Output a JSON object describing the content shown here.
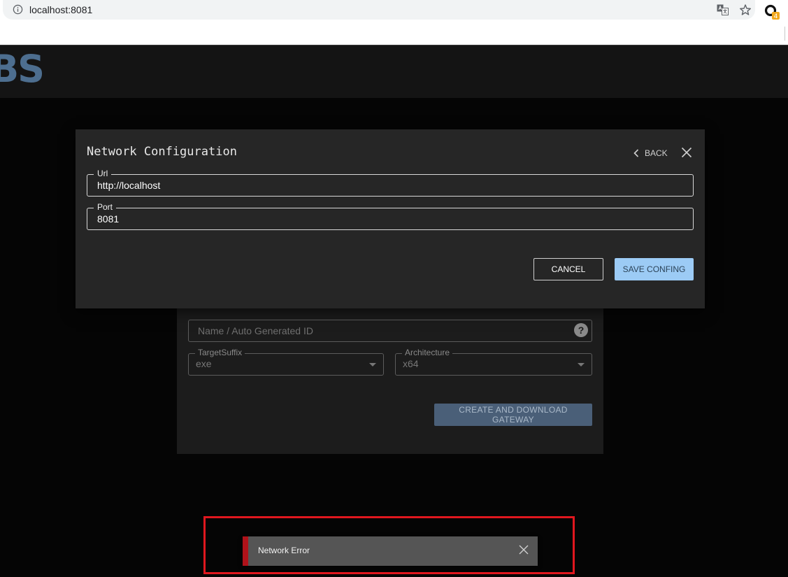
{
  "browser": {
    "url": "localhost:8081",
    "extension_badge": "4"
  },
  "app": {
    "brand_fragment": "BS"
  },
  "background_form": {
    "name_placeholder": "Name / Auto Generated ID",
    "help_glyph": "?",
    "target_suffix": {
      "label": "TargetSuffix",
      "value": "exe"
    },
    "architecture": {
      "label": "Architecture",
      "value": "x64"
    },
    "create_button": "CREATE AND DOWNLOAD GATEWAY"
  },
  "modal": {
    "title": "Network Configuration",
    "back_label": "BACK",
    "url_field": {
      "label": "Url",
      "value": "http://localhost"
    },
    "port_field": {
      "label": "Port",
      "value": "8081"
    },
    "cancel_label": "CANCEL",
    "save_label": "SAVE CONFING"
  },
  "toast": {
    "message": "Network Error",
    "accent_color": "#b0121a"
  },
  "colors": {
    "save_button": "#9ccbf5",
    "create_button": "#4a5f78",
    "highlight": "#e0171e",
    "brand": "#4d6e8f"
  }
}
